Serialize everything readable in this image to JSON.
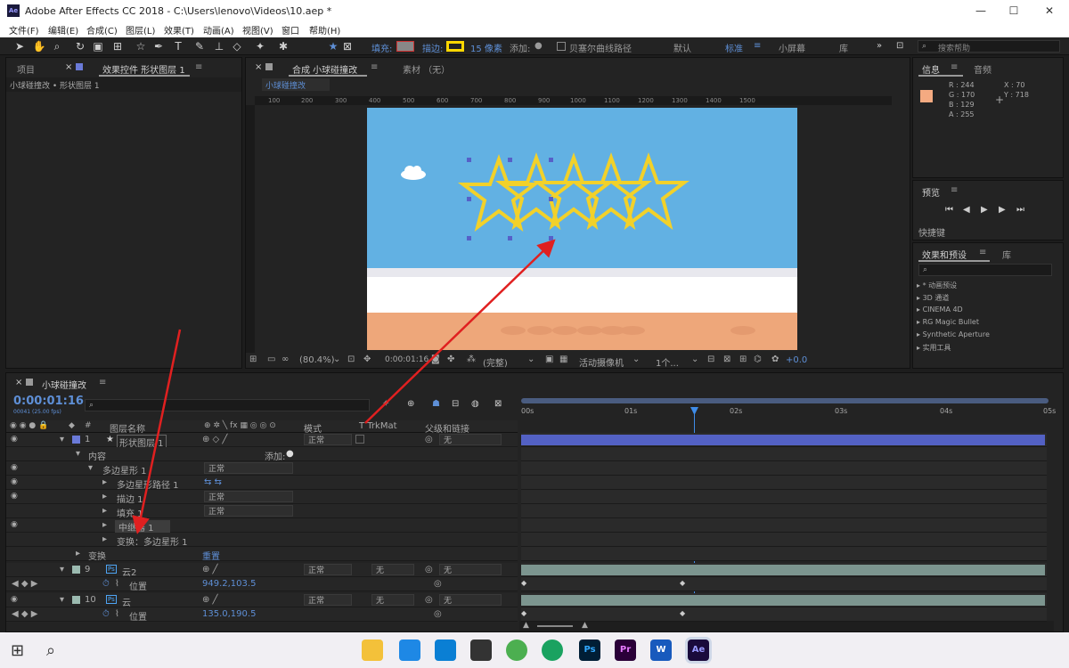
{
  "window": {
    "title": "Adobe After Effects CC 2018 - C:\\Users\\lenovo\\Videos\\10.aep *",
    "minimize": "—",
    "maximize": "☐",
    "close": "✕",
    "logo": "Ae"
  },
  "menu": [
    "文件(F)",
    "编辑(E)",
    "合成(C)",
    "图层(L)",
    "效果(T)",
    "动画(A)",
    "视图(V)",
    "窗口",
    "帮助(H)"
  ],
  "toolbar": {
    "fill": "填充:",
    "stroke": "描边:",
    "stroke_px": "15 像素",
    "add": "添加:",
    "bezier": "贝塞尔曲线路径",
    "default": "默认",
    "standard": "标准",
    "small": "小屏幕",
    "library": "库",
    "search_placeholder": "搜索帮助"
  },
  "left_panel": {
    "tab_project": "项目",
    "tab_effects": "效果控件 形状图层 1",
    "breadcrumb": "小球碰撞改 • 形状图层 1"
  },
  "comp_panel": {
    "tab": "合成 小球碰撞改",
    "tab_footage": "素材 （无）",
    "comp_name": "小球碰撞改",
    "zoom": "(80.4%)",
    "timecode": "0:00:01:16",
    "quality": "(完整)",
    "camera": "活动摄像机",
    "views": "1个...",
    "exposure": "+0.0"
  },
  "ruler_ticks": [
    "100",
    "200",
    "300",
    "400",
    "500",
    "600",
    "700",
    "800",
    "900",
    "1000",
    "1100",
    "1200",
    "1300",
    "1400",
    "1500"
  ],
  "info": {
    "tab_info": "信息",
    "tab_audio": "音频",
    "r": "R : 244",
    "g": "G : 170",
    "b": "B : 129",
    "a": "A : 255",
    "x": "X : 70",
    "y": "Y : 718",
    "swatch": "#f4aa81"
  },
  "preview": {
    "tab": "预览",
    "shortcut": "快捷键"
  },
  "effects_presets": {
    "tab": "效果和预设",
    "tab_lib": "库",
    "items": [
      "* 动画预设",
      "3D 通道",
      "CINEMA 4D",
      "RG Magic Bullet",
      "Synthetic Aperture",
      "实用工具"
    ]
  },
  "timeline": {
    "tab": "小球碰撞改",
    "timecode": "0:00:01:16",
    "fps": "00041 (25.00 fps)",
    "col_layer_name": "图层名称",
    "col_mode": "模式",
    "col_trkmat": "T  TrkMat",
    "col_parent": "父级和链接",
    "ticks": [
      "00s",
      "01s",
      "02s",
      "03s",
      "04s",
      "05s"
    ]
  },
  "layers": [
    {
      "num": "1",
      "name": "形状图层 1",
      "mode": "正常",
      "parent": "无"
    },
    {
      "label": "内容",
      "add": "添加:"
    },
    {
      "label": "多边星形 1",
      "mode": "正常"
    },
    {
      "label": "多边星形路径 1"
    },
    {
      "label": "描边 1",
      "mode": "正常"
    },
    {
      "label": "填充 1",
      "mode": "正常"
    },
    {
      "label": "中继器 1"
    },
    {
      "label": "变换：多边星形 1"
    },
    {
      "label": "变换",
      "reset": "重置"
    },
    {
      "num": "9",
      "name": "云2",
      "mode": "正常",
      "trk": "无",
      "parent": "无"
    },
    {
      "label": "位置",
      "value": "949.2,103.5"
    },
    {
      "num": "10",
      "name": "云",
      "mode": "正常",
      "trk": "无",
      "parent": "无"
    },
    {
      "label": "位置",
      "value": "135.0,190.5"
    }
  ],
  "taskbar_icons": [
    "Ps",
    "Pr",
    "W",
    "Ae"
  ]
}
